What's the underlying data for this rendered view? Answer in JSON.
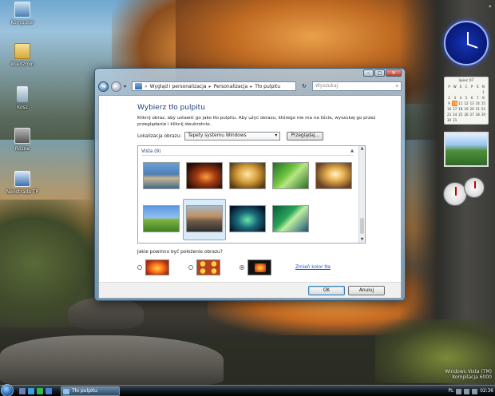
{
  "desktop": {
    "icons": [
      {
        "label": "Komputer"
      },
      {
        "label": "Wiedźmin"
      },
      {
        "label": "Kosz"
      },
      {
        "label": "Różne"
      },
      {
        "label": "Neostrada TP"
      }
    ],
    "top_right": "»",
    "watermark": {
      "line1": "Windows Vista (TM)",
      "line2": "Kompilacja 6000"
    }
  },
  "gadgets": {
    "calendar": {
      "title": "lipiec 07",
      "weekdays": [
        "P",
        "W",
        "Ś",
        "C",
        "P",
        "S",
        "N"
      ],
      "days": [
        "",
        "",
        "",
        "",
        "",
        "",
        "1",
        "2",
        "3",
        "4",
        "5",
        "6",
        "7",
        "8",
        "9",
        "10",
        "11",
        "12",
        "13",
        "14",
        "15",
        "16",
        "17",
        "18",
        "19",
        "20",
        "21",
        "22",
        "23",
        "24",
        "25",
        "26",
        "27",
        "28",
        "29",
        "30",
        "31"
      ],
      "today": "10"
    }
  },
  "window": {
    "caption_buttons": {
      "minimize": "–",
      "maximize": "□",
      "close": "✕"
    },
    "breadcrumb": [
      "Wygląd i personalizacja",
      "Personalizacja",
      "Tło pulpitu"
    ],
    "search_placeholder": "Wyszukaj",
    "title": "Wybierz tło pulpitu",
    "intro": "Kliknij obraz, aby ustawić go jako tło pulpitu. Aby użyć obrazu, którego nie ma na liście, wyszukaj go przez przeglądanie i kliknij dwukrotnie.",
    "location_label": "Lokalizacja obrazu:",
    "location_value": "Tapety systemu Windows",
    "browse_button": "Przeglądaj...",
    "group_header": "Vista (9)",
    "position_question": "Jakie powinno być położenie obrazu?",
    "change_color_link": "Zmień kolor tła",
    "ok_button": "OK",
    "cancel_button": "Anuluj"
  },
  "taskbar": {
    "task_label": "Tło pulpitu",
    "language": "PL",
    "clock": "02:36"
  },
  "colors": {
    "title_blue": "#1e3d7a",
    "link_blue": "#1a53c9",
    "selection": "#d9ebf9"
  }
}
